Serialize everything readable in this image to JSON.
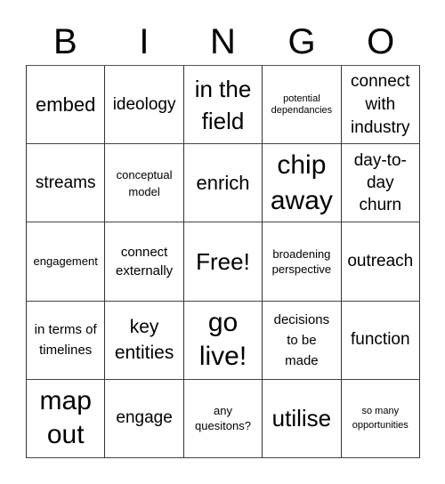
{
  "header": [
    "B",
    "I",
    "N",
    "G",
    "O"
  ],
  "cells": [
    [
      "embed",
      "ideology",
      "in the field",
      "potential dependancies",
      "connect with industry"
    ],
    [
      "streams",
      "conceptual model",
      "enrich",
      "chip away",
      "day-to-day churn"
    ],
    [
      "engagement",
      "connect externally",
      "Free!",
      "broadening perspective",
      "outreach"
    ],
    [
      "in terms of timelines",
      "key entities",
      "go live!",
      "decisions to be made",
      "function"
    ],
    [
      "map out",
      "engage",
      "any quesitons?",
      "utilise",
      "so many opportunities"
    ]
  ]
}
